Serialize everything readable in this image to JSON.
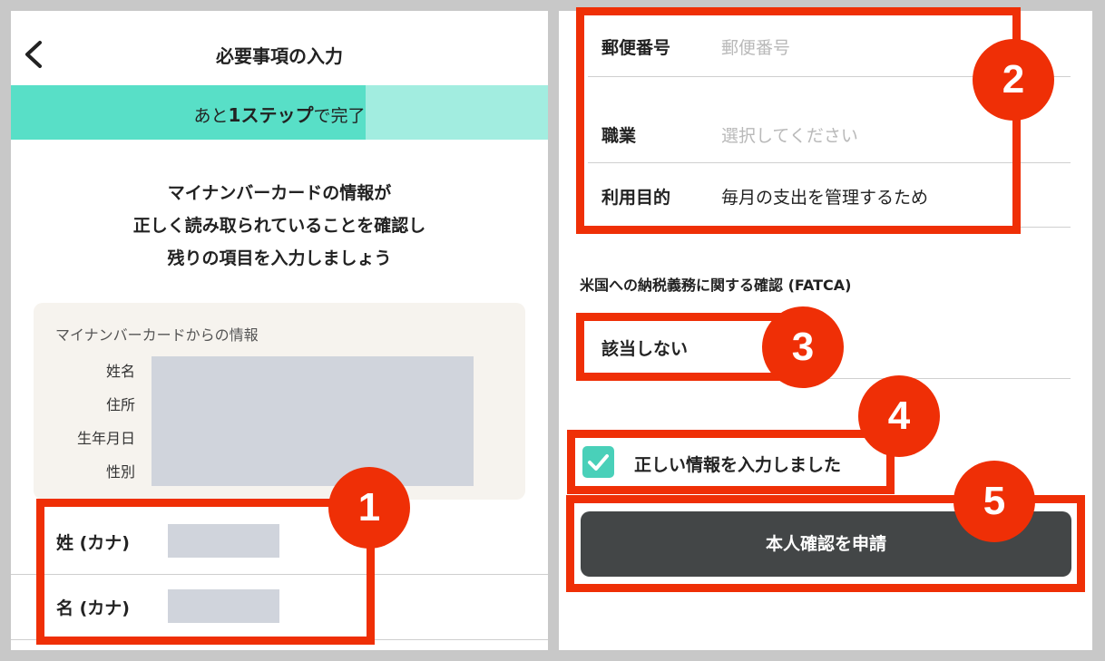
{
  "header": {
    "back_icon": "chevron-left-icon",
    "title": "必要事項の入力"
  },
  "progress": {
    "prefix": "あと",
    "bold": "1ステップ",
    "suffix": "で完了",
    "fraction": 0.66,
    "fill_color": "#58dfc7",
    "track_color": "#a2ede0"
  },
  "intro": {
    "line1": "マイナンバーカードの情報が",
    "line2": "正しく読み取られていることを確認し",
    "line3": "残りの項目を入力しましょう"
  },
  "card_info": {
    "title": "マイナンバーカードからの情報",
    "labels": [
      "姓名",
      "住所",
      "生年月日",
      "性別"
    ]
  },
  "kana_fields": [
    {
      "label": "姓 (カナ)"
    },
    {
      "label": "名 (カナ)"
    }
  ],
  "postal": {
    "label": "郵便番号",
    "placeholder": "郵便番号"
  },
  "occupation": {
    "label": "職業",
    "placeholder": "選択してください"
  },
  "purpose": {
    "label": "利用目的",
    "value": "毎月の支出を管理するため"
  },
  "fatca": {
    "heading": "米国への納税義務に関する確認 (FATCA)",
    "value": "該当しない"
  },
  "confirm": {
    "checked": true,
    "label": "正しい情報を入力しました",
    "check_icon": "checkmark-icon"
  },
  "submit": {
    "label": "本人確認を申請"
  },
  "markers": [
    "1",
    "2",
    "3",
    "4",
    "5"
  ],
  "colors": {
    "accent": "#ef2f06",
    "checkbox": "#49d0b9",
    "button": "#434647"
  }
}
